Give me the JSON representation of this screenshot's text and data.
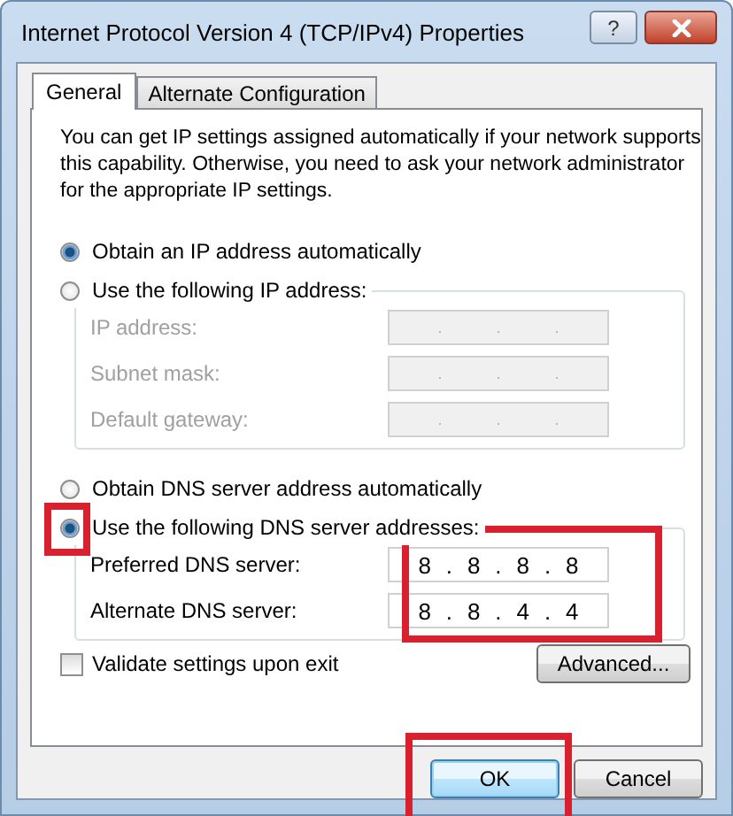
{
  "window": {
    "title": "Internet Protocol Version 4 (TCP/IPv4) Properties",
    "help_button": "?"
  },
  "tabs": [
    {
      "label": "General",
      "selected": true
    },
    {
      "label": "Alternate Configuration",
      "selected": false
    }
  ],
  "intro": "You can get IP settings assigned automatically if your network supports this capability. Otherwise, you need to ask your network administrator for the appropriate IP settings.",
  "ip": {
    "auto_option": {
      "label": "Obtain an IP address automatically",
      "selected": true,
      "highlighted": false
    },
    "manual_option": {
      "label": "Use the following IP address:",
      "selected": false,
      "highlighted": false
    },
    "disabled": true,
    "highlighted": false,
    "fields": [
      {
        "label": "IP address:",
        "separators": [
          ".",
          ".",
          "."
        ]
      },
      {
        "label": "Subnet mask:",
        "separators": [
          ".",
          ".",
          "."
        ]
      },
      {
        "label": "Default gateway:",
        "separators": [
          ".",
          ".",
          "."
        ]
      }
    ]
  },
  "dns": {
    "auto_option": {
      "label": "Obtain DNS server address automatically",
      "selected": false,
      "highlighted": false
    },
    "manual_option": {
      "label": "Use the following DNS server addresses:",
      "selected": true,
      "highlighted": true
    },
    "disabled": false,
    "highlighted": true,
    "fields": [
      {
        "label": "Preferred DNS server:",
        "octets": [
          "8",
          "8",
          "8",
          "8"
        ],
        "separators": [
          ".",
          ".",
          "."
        ]
      },
      {
        "label": "Alternate DNS server:",
        "octets": [
          "8",
          "8",
          "4",
          "4"
        ],
        "separators": [
          ".",
          ".",
          "."
        ]
      }
    ]
  },
  "validate": {
    "label": "Validate settings upon exit",
    "checked": false
  },
  "advanced_button": "Advanced...",
  "buttons": [
    {
      "label": "OK",
      "default": true,
      "highlighted": true
    },
    {
      "label": "Cancel",
      "default": false,
      "highlighted": false
    }
  ]
}
